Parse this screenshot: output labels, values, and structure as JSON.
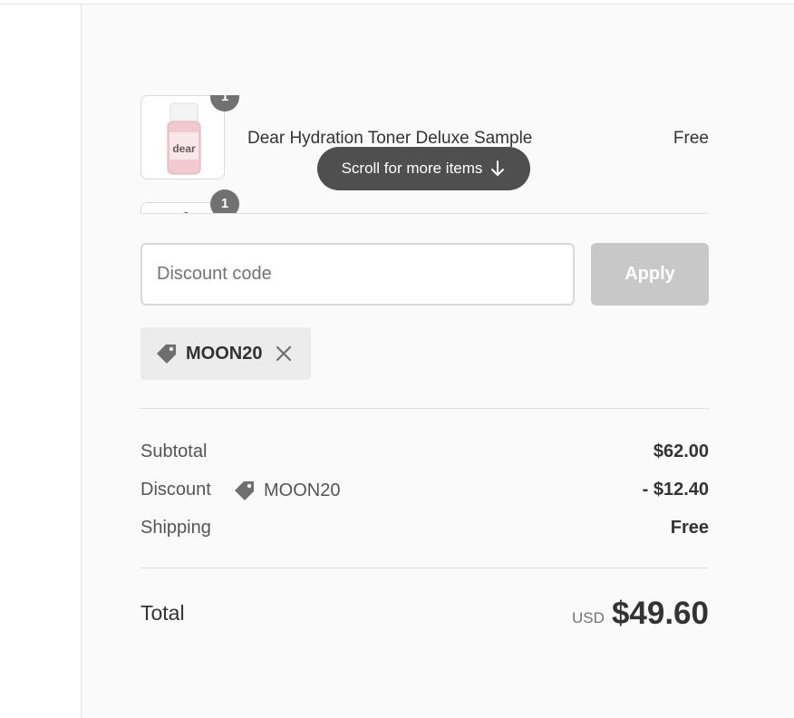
{
  "order_summary": {
    "items": [
      {
        "name": "Dear Hydration Toner Deluxe Sample",
        "price": "Free",
        "quantity": "1",
        "thumbnail_icon": "toner-bottle-image",
        "thumbnail_text": "dear"
      },
      {
        "name": "",
        "price": "",
        "quantity": "1",
        "thumbnail_icon": "product-image"
      }
    ],
    "scroll_hint": {
      "label": "Scroll for more items",
      "icon": "arrow-down-icon"
    },
    "discount": {
      "placeholder": "Discount code",
      "value": "",
      "apply_label": "Apply",
      "applied_code": "MOON20",
      "tag_icon": "tag-icon",
      "remove_icon": "close-icon"
    },
    "totals": {
      "subtotal_label": "Subtotal",
      "subtotal_value": "$62.00",
      "discount_label": "Discount",
      "discount_code": "MOON20",
      "discount_value": "- $12.40",
      "shipping_label": "Shipping",
      "shipping_value": "Free",
      "total_label": "Total",
      "currency": "USD",
      "total_value": "$49.60"
    }
  },
  "colors": {
    "panel_background": "#fafafa",
    "badge": "#717171",
    "apply_disabled": "#c8c8c8",
    "chip_background": "#ececec",
    "scroll_pill": "#424242"
  }
}
